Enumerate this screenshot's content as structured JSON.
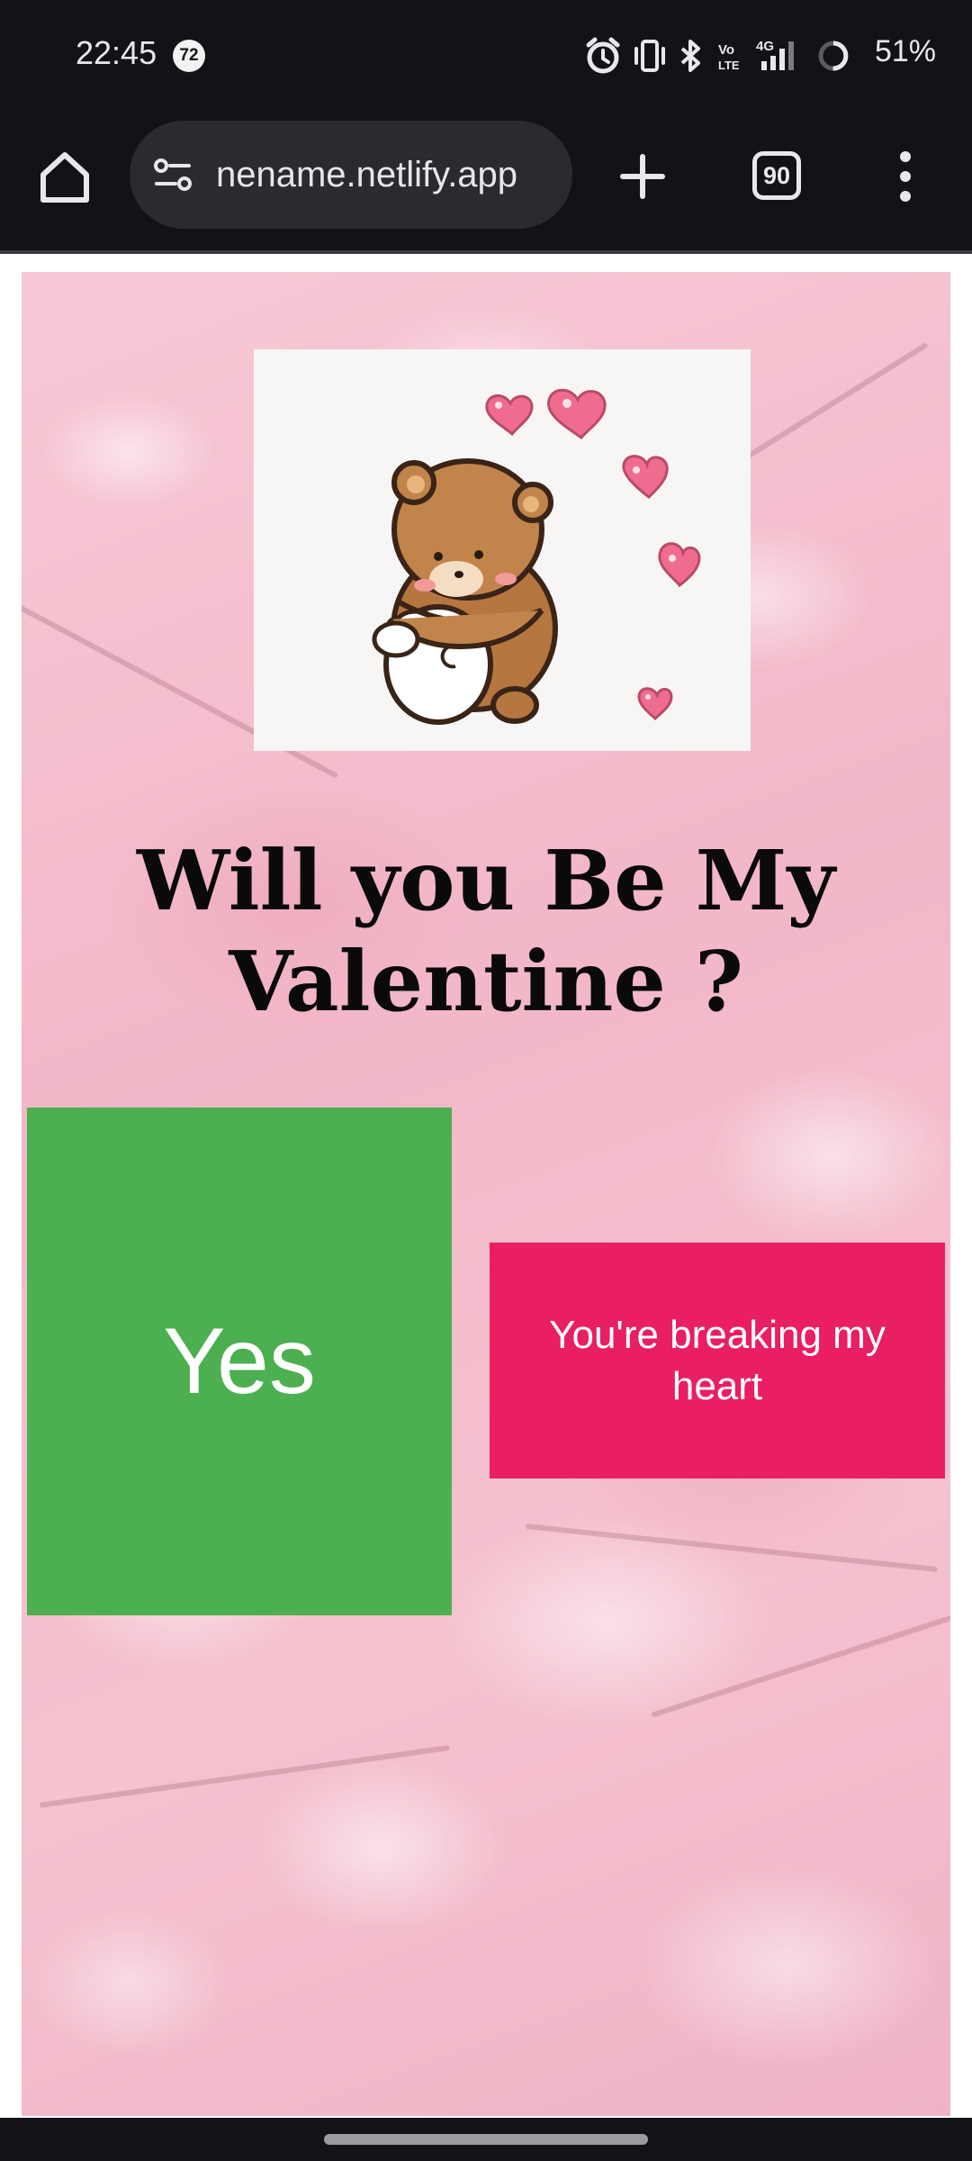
{
  "status_bar": {
    "time": "22:45",
    "notification_count": "72",
    "battery_percent": "51%",
    "icons": [
      "alarm-icon",
      "vibrate-icon",
      "bluetooth-icon",
      "volte-icon",
      "signal-4g-icon",
      "battery-icon"
    ]
  },
  "browser": {
    "url": "nename.netlify.app",
    "tab_count": "90",
    "icons": [
      "home-icon",
      "site-info-icon",
      "plus-icon",
      "tab-switcher-icon",
      "more-vert-icon"
    ]
  },
  "page": {
    "image_alt": "bear hugging bunny with hearts",
    "headline_line1": "Will you Be My",
    "headline_line2": "Valentine ?",
    "yes_label": "Yes",
    "no_label": "You're breaking my heart",
    "colors": {
      "yes": "#4caf50",
      "no": "#e91e63",
      "background": "#f4bfcf"
    }
  }
}
